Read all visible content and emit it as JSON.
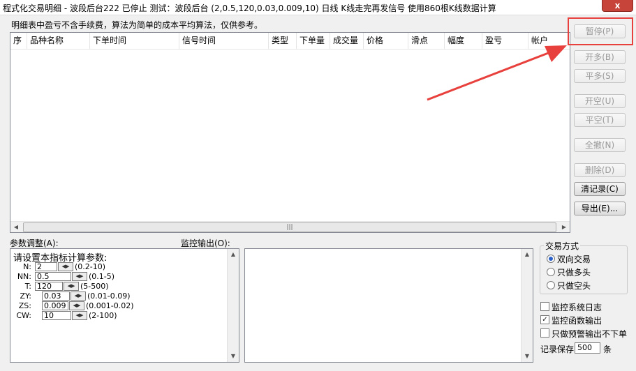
{
  "window": {
    "title": "程式化交易明细 - 波段后台222 已停止  测试：波段后台 (2,0.5,120,0.03,0.009,10) 日线 K线走完再发信号 使用860根K线数据计算",
    "close_glyph": "x"
  },
  "note": "明细表中盈亏不含手续费，算法为简单的成本平均算法，仅供参考。",
  "table": {
    "columns": [
      "序",
      "品种名称",
      "下单时间",
      "信号时间",
      "类型",
      "下单量",
      "成交量",
      "价格",
      "滑点",
      "幅度",
      "盈亏",
      "帐户"
    ],
    "rows": []
  },
  "buttons": {
    "pause": "暂停(P)",
    "open_long": "开多(B)",
    "close_long": "平多(S)",
    "open_short": "开空(U)",
    "close_short": "平空(T)",
    "cancel_all": "全撤(N)",
    "delete": "删除(D)",
    "clear": "清记录(C)",
    "export": "导出(E)..."
  },
  "params": {
    "label": "参数调整(A):",
    "title": "请设置本指标计算参数:",
    "items": [
      {
        "name": "N:",
        "value": "2",
        "range": "(0.2-10)"
      },
      {
        "name": "NN:",
        "value": "0.5",
        "range": "(0.1-5)"
      },
      {
        "name": "T:",
        "value": "120",
        "range": "(5-500)"
      },
      {
        "name": "ZY:",
        "value": "0.03",
        "range": "(0.01-0.09)"
      },
      {
        "name": "ZS:",
        "value": "0.009",
        "range": "(0.001-0.02)"
      },
      {
        "name": "CW:",
        "value": "10",
        "range": "(2-100)"
      }
    ]
  },
  "monitor": {
    "label": "监控输出(O):"
  },
  "trade_mode": {
    "label": "交易方式",
    "options": [
      "双向交易",
      "只做多头",
      "只做空头"
    ],
    "selected": "双向交易"
  },
  "options": {
    "monitor_log": "监控系统日志",
    "monitor_func": "监控函数输出",
    "alert_only": "只做预警输出不下单",
    "keep_label": "记录保存",
    "keep_value": "500",
    "keep_unit": "条"
  },
  "colors": {
    "highlight": "#e8413d",
    "arrow": "#e8413d",
    "close": "#c7443a"
  }
}
